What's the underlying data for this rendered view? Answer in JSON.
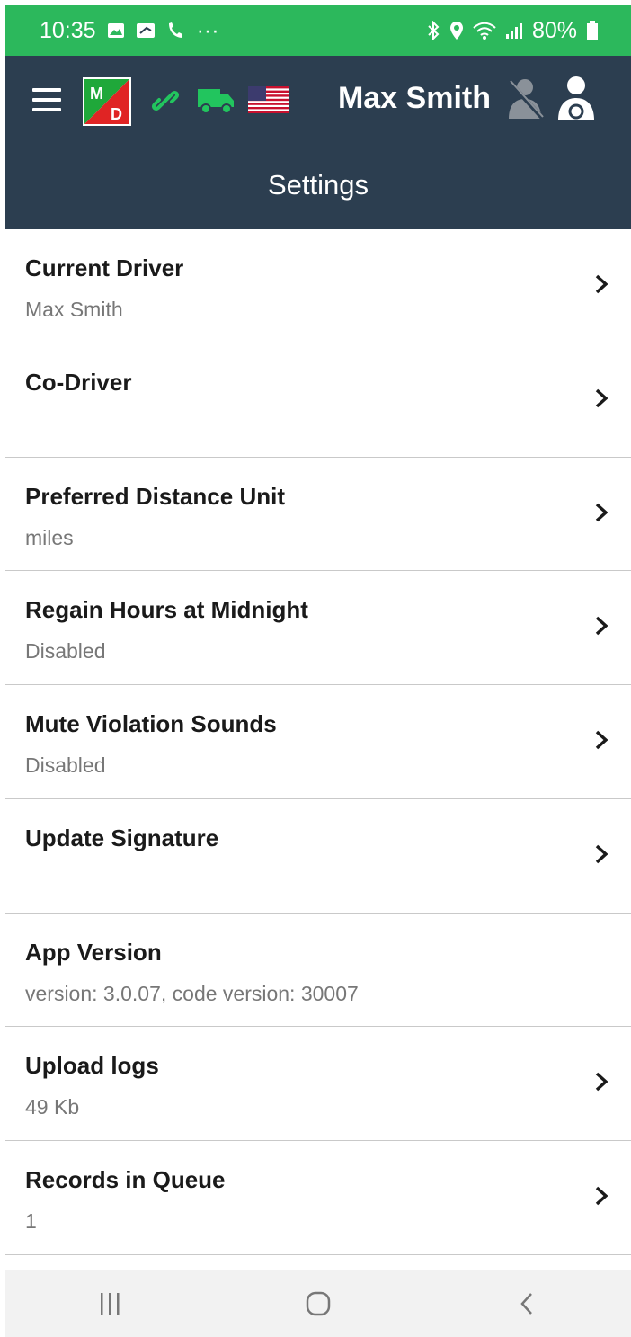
{
  "status_bar": {
    "time": "10:35",
    "notification_icons": [
      "gallery-icon",
      "image-notification-icon",
      "phone-call-icon",
      "more-dots-icon"
    ],
    "system_icons": [
      "bluetooth-icon",
      "location-icon",
      "wifi-icon",
      "signal-icon"
    ],
    "battery": "80%",
    "more_dots": "···",
    "colors": {
      "background": "#2cb85c"
    }
  },
  "header": {
    "driver_name": "Max Smith",
    "title": "Settings",
    "logo_text_top": "M",
    "logo_text_bottom": "D",
    "colors": {
      "background": "#2c3e50",
      "status_green": "#22c55e"
    }
  },
  "settings": {
    "items": [
      {
        "title": "Current Driver",
        "value": "Max Smith",
        "has_chevron": true
      },
      {
        "title": "Co-Driver",
        "value": "",
        "has_chevron": true
      },
      {
        "title": "Preferred Distance Unit",
        "value": "miles",
        "has_chevron": true
      },
      {
        "title": "Regain Hours at Midnight",
        "value": "Disabled",
        "has_chevron": true
      },
      {
        "title": "Mute Violation Sounds",
        "value": "Disabled",
        "has_chevron": true
      },
      {
        "title": "Update Signature",
        "value": "",
        "has_chevron": true
      },
      {
        "title": "App Version",
        "value": "version: 3.0.07,  code version: 30007",
        "has_chevron": false
      },
      {
        "title": "Upload logs",
        "value": "49 Kb",
        "has_chevron": true
      },
      {
        "title": "Records in Queue",
        "value": "1",
        "has_chevron": true
      }
    ]
  },
  "nav_bar": {
    "buttons": [
      "recent-apps-icon",
      "home-icon",
      "back-icon"
    ]
  }
}
